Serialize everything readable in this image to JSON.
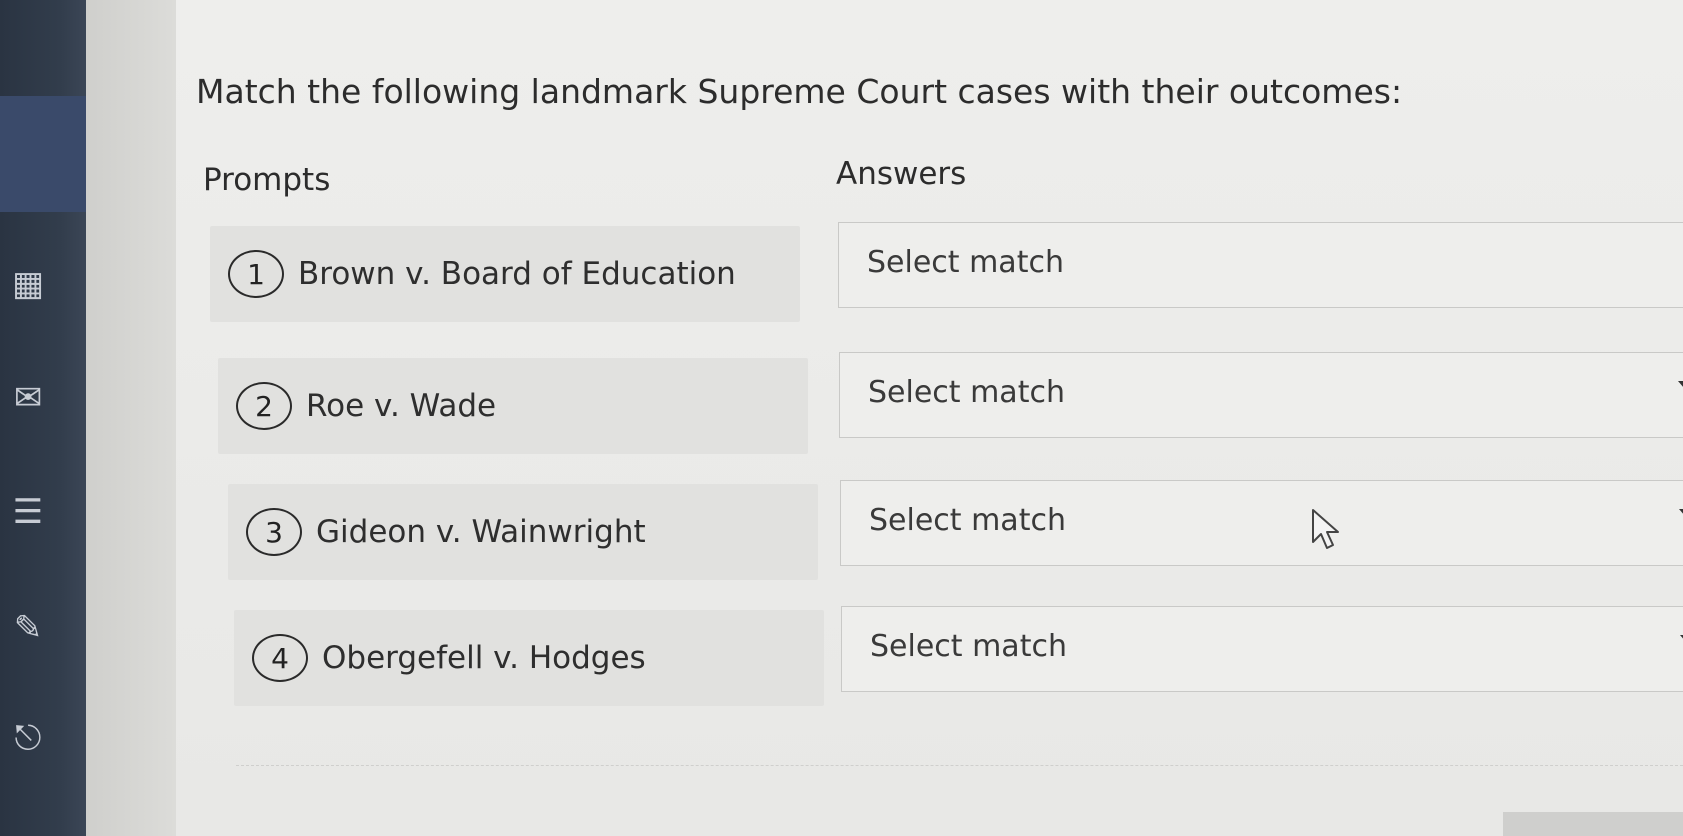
{
  "question": "Match the following landmark Supreme Court cases with their outcomes:",
  "columns": {
    "prompts": "Prompts",
    "answers": "Answers"
  },
  "prompts": [
    {
      "number": "1",
      "text": "Brown v. Board of Education"
    },
    {
      "number": "2",
      "text": "Roe v. Wade"
    },
    {
      "number": "3",
      "text": "Gideon v. Wainwright"
    },
    {
      "number": "4",
      "text": "Obergefell v. Hodges"
    }
  ],
  "answers": [
    {
      "placeholder": "Select match"
    },
    {
      "placeholder": "Select match"
    },
    {
      "placeholder": "Select match"
    },
    {
      "placeholder": "Select match"
    }
  ],
  "icons": {
    "sidebar": [
      "grid-icon",
      "mail-icon",
      "document-icon",
      "edit-icon",
      "exit-icon"
    ],
    "dropdown": "chevron-down-icon",
    "cursor": "mouse-pointer-icon"
  }
}
